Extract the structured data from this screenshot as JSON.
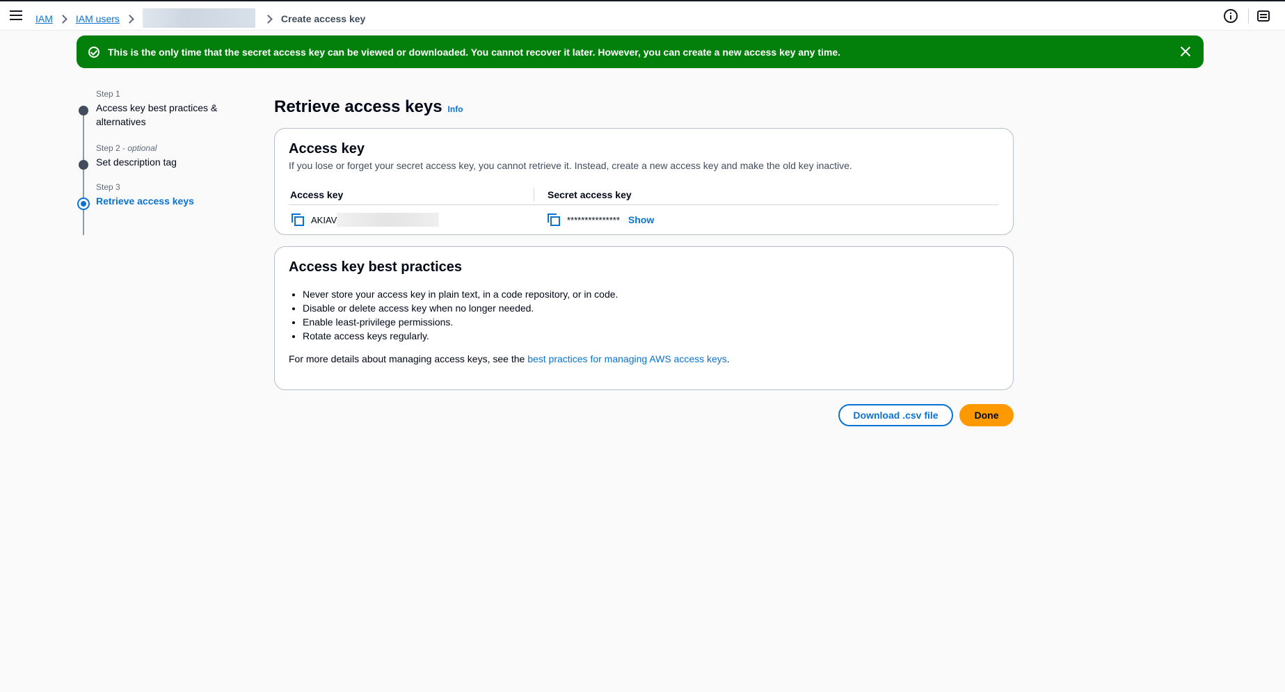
{
  "header": {
    "breadcrumb": {
      "items": [
        {
          "label": "IAM"
        },
        {
          "label": "IAM users"
        }
      ],
      "current": "Create access key"
    }
  },
  "flash": {
    "message": "This is the only time that the secret access key can be viewed or downloaded. You cannot recover it later. However, you can create a new access key any time.",
    "color": "#037f0c"
  },
  "steps": [
    {
      "label": "Step 1",
      "optional": "",
      "title": "Access key best practices & alternatives"
    },
    {
      "label": "Step 2",
      "optional": "optional",
      "title": "Set description tag"
    },
    {
      "label": "Step 3",
      "optional": "",
      "title": "Retrieve access keys"
    }
  ],
  "main": {
    "title": "Retrieve access keys",
    "info_link": "Info",
    "access_key_panel": {
      "title": "Access key",
      "description": "If you lose or forget your secret access key, you cannot retrieve it. Instead, create a new access key and make the old key inactive.",
      "columns": [
        "Access key",
        "Secret access key"
      ],
      "access_key_value": "AKIAV",
      "secret_value": "***************",
      "show_label": "Show"
    },
    "best_practices_panel": {
      "title": "Access key best practices",
      "items": [
        "Never store your access key in plain text, in a code repository, or in code.",
        "Disable or delete access key when no longer needed.",
        "Enable least-privilege permissions.",
        "Rotate access keys regularly."
      ],
      "footer_prefix": "For more details about managing access keys, see the ",
      "footer_link": "best practices for managing AWS access keys",
      "footer_suffix": "."
    },
    "buttons": {
      "download": "Download .csv file",
      "done": "Done"
    }
  },
  "colors": {
    "accent": "#0972d3",
    "primary_button": "#ff9900",
    "success": "#037f0c"
  }
}
